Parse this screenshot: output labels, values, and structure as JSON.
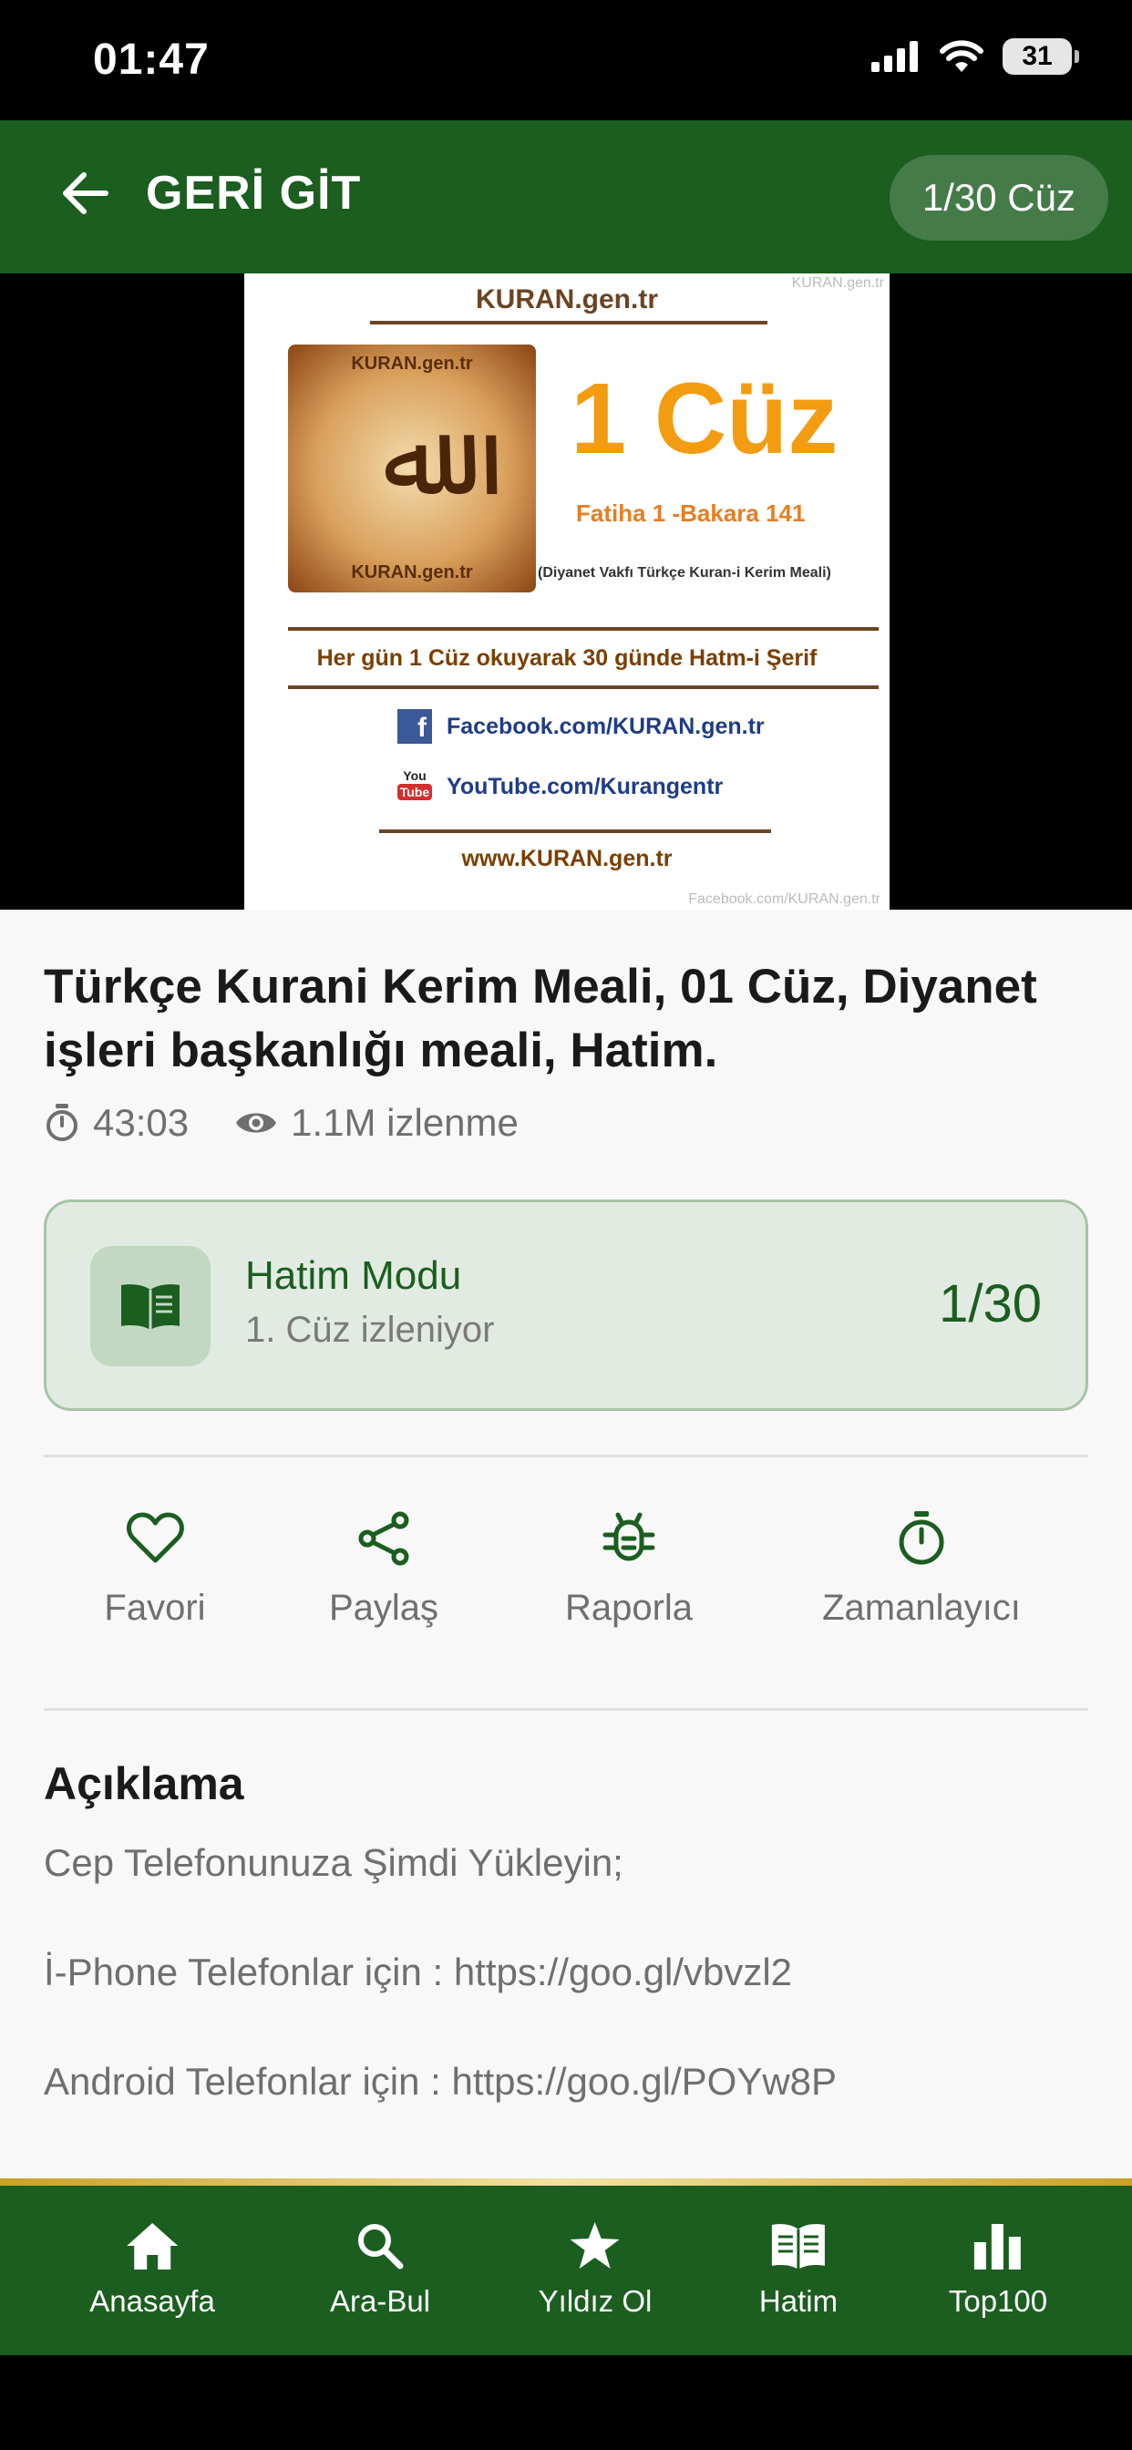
{
  "status_bar": {
    "time": "01:47",
    "battery": "31"
  },
  "header": {
    "back_label": "GERİ GİT",
    "juz_badge": "1/30 Cüz"
  },
  "video": {
    "site_top": "KURAN.gen.tr",
    "watermark_top": "KURAN.gen.tr",
    "parchment_top": "KURAN.gen.tr",
    "parchment_bottom": "KURAN.gen.tr",
    "big_title": "1 Cüz",
    "verse_range": "Fatiha 1  -Bakara 141",
    "meal_note": "(Diyanet Vakfı Türkçe Kuran-i Kerim Meali)",
    "daily_line": "Her gün 1 Cüz okuyarak 30 günde Hatm-i Şerif",
    "facebook": "Facebook.com/KURAN.gen.tr",
    "youtube": "YouTube.com/Kurangentr",
    "site_bottom": "www.KURAN.gen.tr",
    "watermark_bottom": "Facebook.com/KURAN.gen.tr",
    "yt_you": "You",
    "yt_tube": "Tube"
  },
  "content": {
    "title": "Türkçe Kurani Kerim Meali, 01 Cüz, Diyanet işleri başkanlığı meali, Hatim.",
    "duration": "43:03",
    "views": "1.1M izlenme"
  },
  "hatim": {
    "title": "Hatim Modu",
    "subtitle": "1. Cüz izleniyor",
    "progress": "1/30"
  },
  "actions": [
    {
      "label": "Favori",
      "icon": "heart-icon"
    },
    {
      "label": "Paylaş",
      "icon": "share-icon"
    },
    {
      "label": "Raporla",
      "icon": "bug-icon"
    },
    {
      "label": "Zamanlayıcı",
      "icon": "timer-icon"
    }
  ],
  "description": {
    "title": "Açıklama",
    "lines": [
      "Cep Telefonunuza Şimdi Yükleyin;",
      "İ-Phone Telefonlar için : https://goo.gl/vbvzl2",
      "Android Telefonlar için : https://goo.gl/POYw8P"
    ]
  },
  "bottom_nav": [
    {
      "label": "Anasayfa",
      "icon": "home-icon"
    },
    {
      "label": "Ara-Bul",
      "icon": "search-icon"
    },
    {
      "label": "Yıldız Ol",
      "icon": "star-icon"
    },
    {
      "label": "Hatim",
      "icon": "book-icon"
    },
    {
      "label": "Top100",
      "icon": "bar-chart-icon"
    }
  ],
  "colors": {
    "primary": "#1b5e20",
    "accent_gold": "#c9a227",
    "background": "#f8f8f8"
  }
}
